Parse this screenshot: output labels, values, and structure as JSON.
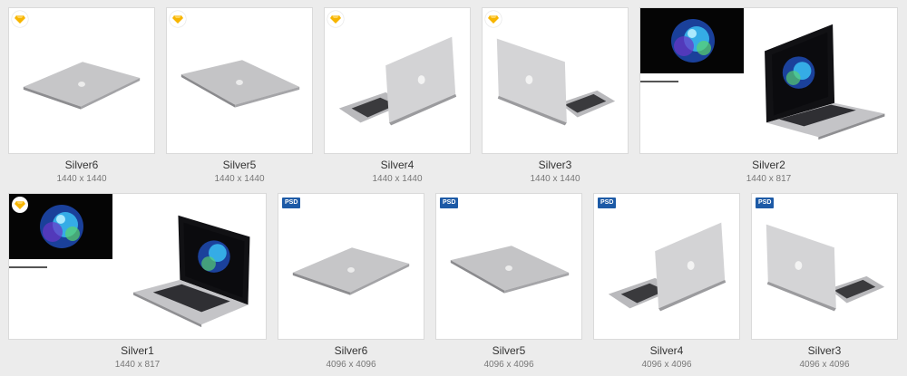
{
  "items": [
    {
      "name": "Silver6",
      "dims": "1440 x 1440",
      "badge": "sketch"
    },
    {
      "name": "Silver5",
      "dims": "1440 x 1440",
      "badge": "sketch"
    },
    {
      "name": "Silver4",
      "dims": "1440 x 1440",
      "badge": "sketch"
    },
    {
      "name": "Silver3",
      "dims": "1440 x 1440",
      "badge": "sketch"
    },
    {
      "name": "Silver2",
      "dims": "1440 x 817",
      "badge": "none"
    },
    {
      "name": "Silver1",
      "dims": "1440 x 817",
      "badge": "sketch"
    },
    {
      "name": "Silver6",
      "dims": "4096 x 4096",
      "badge": "psd"
    },
    {
      "name": "Silver5",
      "dims": "4096 x 4096",
      "badge": "psd"
    },
    {
      "name": "Silver4",
      "dims": "4096 x 4096",
      "badge": "psd"
    },
    {
      "name": "Silver3",
      "dims": "4096 x 4096",
      "badge": "psd"
    }
  ],
  "badges": {
    "psd_label": "PSD",
    "sketch_icon": "sketch-diamond-icon"
  },
  "colors": {
    "sketch_diamond": "#f7b500",
    "psd_badge": "#1d5aa6"
  }
}
